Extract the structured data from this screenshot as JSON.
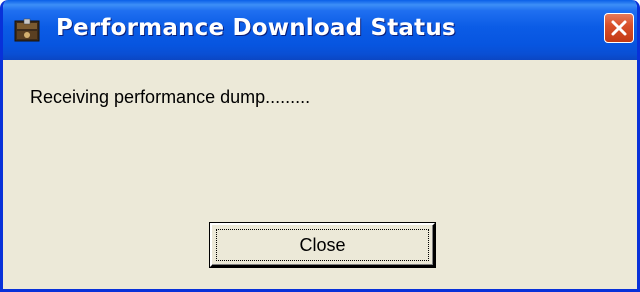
{
  "window": {
    "title": "Performance Download Status",
    "icon": "app-icon",
    "close_icon": "close-icon"
  },
  "body": {
    "message": "Receiving performance dump........."
  },
  "buttons": {
    "close_label": "Close"
  },
  "colors": {
    "titlebar": "#0b5ce6",
    "window_bg": "#ece9d8",
    "close_button_red": "#d9502a",
    "border": "#0831d9"
  }
}
